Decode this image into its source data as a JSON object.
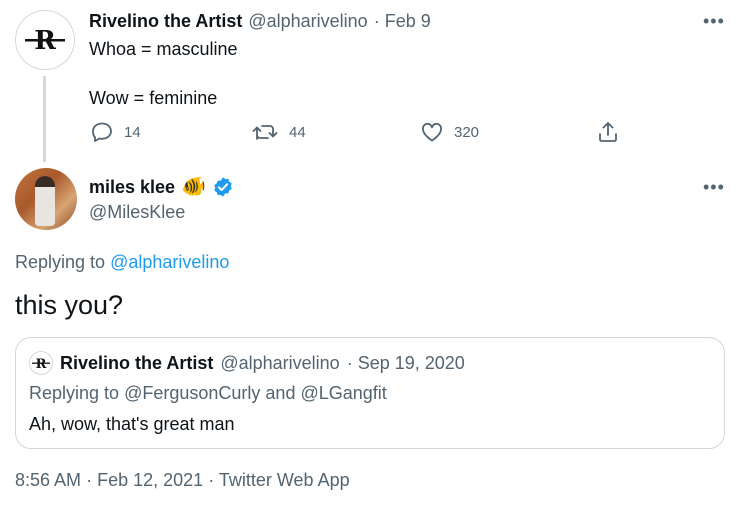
{
  "parent_tweet": {
    "display_name": "Rivelino the Artist",
    "handle": "@alpharivelino",
    "date": "· Feb 9",
    "line1": "Whoa = masculine",
    "line2": "Wow = feminine",
    "reply_count": "14",
    "retweet_count": "44",
    "like_count": "320",
    "avatar_letter": "R",
    "more_label": "•••"
  },
  "reply_tweet": {
    "display_name": "miles klee",
    "emoji": "🐠",
    "handle": "@MilesKlee",
    "replying_prefix": "Replying to",
    "replying_to": "@alpharivelino",
    "text": "this you?",
    "more_label": "•••",
    "verified_color": "#1d9bf0"
  },
  "quoted_tweet": {
    "display_name": "Rivelino the Artist",
    "handle": "@alpharivelino",
    "date": "· Sep 19, 2020",
    "replying_prefix": "Replying to",
    "replying_to_1": "@FergusonCurly",
    "replying_and": "and",
    "replying_to_2": "@LGangfit",
    "text": "Ah, wow, that's great man",
    "avatar_letter": "R"
  },
  "footer": {
    "time": "8:56 AM",
    "sep1": "·",
    "date": "Feb 12, 2021",
    "sep2": "·",
    "client": "Twitter Web App"
  },
  "colors": {
    "accent": "#1d9bf0",
    "muted": "#536471",
    "border": "#cfd9de"
  }
}
